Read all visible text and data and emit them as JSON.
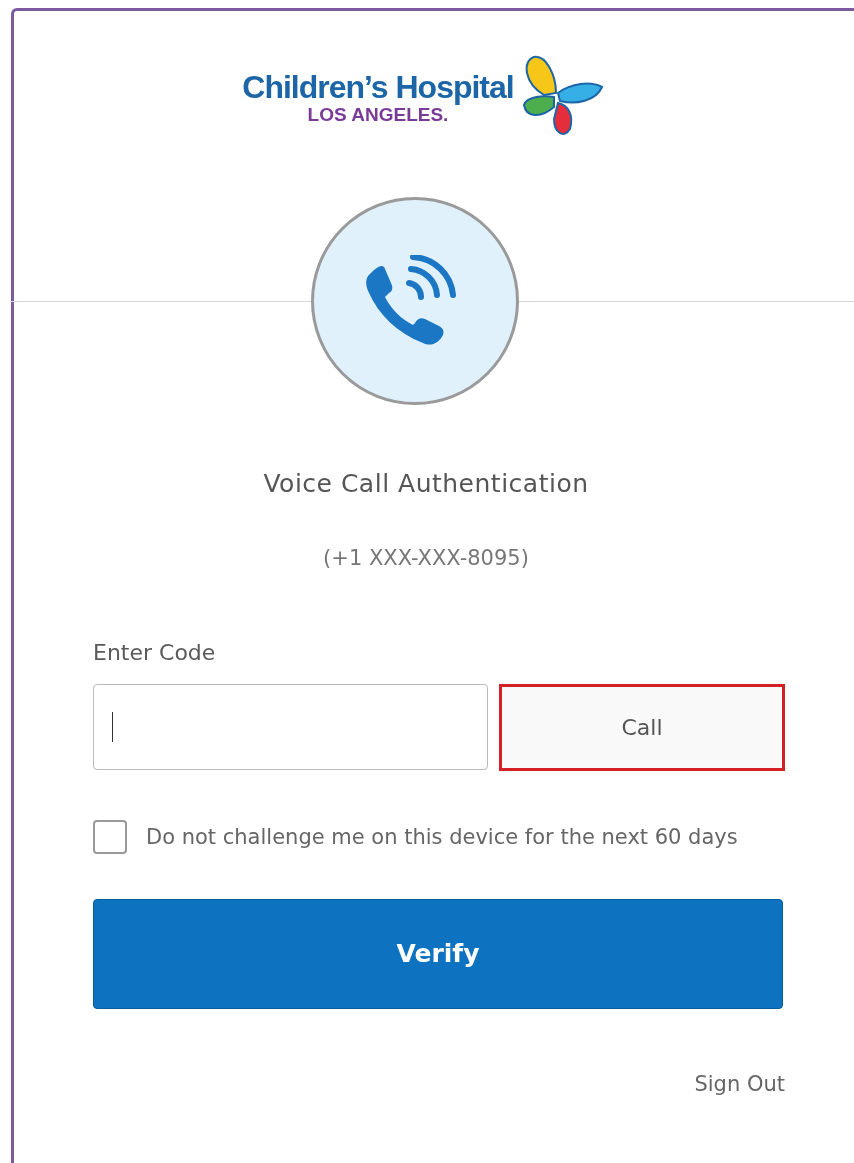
{
  "logo": {
    "name": "Children’s Hospital",
    "location": "LOS ANGELES."
  },
  "title": "Voice Call Authentication",
  "phone": "(+1 XXX-XXX-8095)",
  "code_field": {
    "label": "Enter Code"
  },
  "call_button": {
    "label": "Call",
    "highlighted": true
  },
  "remember": {
    "label": "Do not challenge me on this device for the next 60 days",
    "checked": false
  },
  "verify_button": {
    "label": "Verify"
  },
  "sign_out": "Sign Out"
}
